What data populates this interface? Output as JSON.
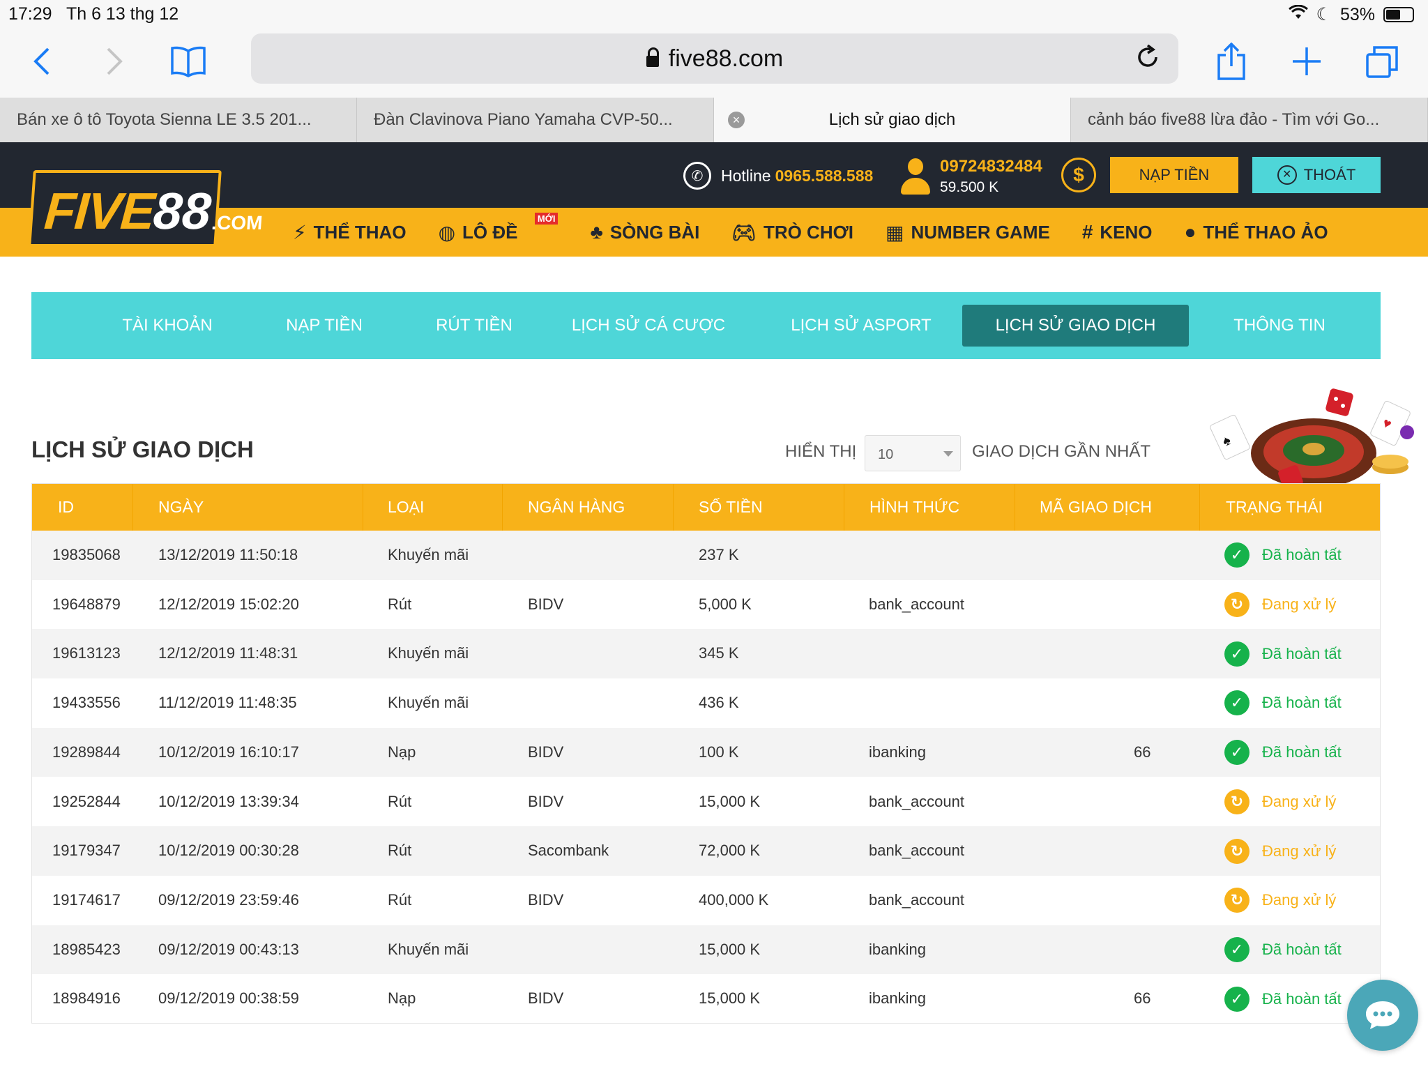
{
  "status_bar": {
    "time": "17:29",
    "date": "Th 6 13 thg 12",
    "battery_percent": "53%"
  },
  "browser": {
    "url": "five88.com",
    "tabs": [
      {
        "title": "Bán xe ô tô Toyota Sienna LE 3.5 201..."
      },
      {
        "title": "Đàn Clavinova Piano Yamaha CVP-50..."
      },
      {
        "title": "Lịch sử giao dịch"
      },
      {
        "title": "cảnh báo five88 lừa đảo - Tìm với Go..."
      }
    ]
  },
  "header": {
    "logo": {
      "part1": "FIVE",
      "part2": "88",
      "part3": ".COM"
    },
    "hotline_label": "Hotline",
    "hotline_number": "0965.588.588",
    "user_phone": "09724832484",
    "user_balance": "59.500 K",
    "deposit_button": "NẠP TIỀN",
    "logout_button": "THOÁT"
  },
  "nav": {
    "items": [
      {
        "label": "THỂ THAO"
      },
      {
        "label": "LÔ ĐỀ",
        "badge": "MỚI"
      },
      {
        "label": "SÒNG BÀI"
      },
      {
        "label": "TRÒ CHƠI"
      },
      {
        "label": "NUMBER GAME"
      },
      {
        "label": "KENO"
      },
      {
        "label": "THỂ THAO ẢO"
      }
    ]
  },
  "account_tabs": [
    {
      "label": "TÀI KHOẢN"
    },
    {
      "label": "NẠP TIỀN"
    },
    {
      "label": "RÚT TIỀN"
    },
    {
      "label": "LỊCH SỬ CÁ CƯỢC"
    },
    {
      "label": "LỊCH SỬ ASPORT"
    },
    {
      "label": "LỊCH SỬ GIAO DỊCH",
      "active": true
    },
    {
      "label": "THÔNG TIN"
    }
  ],
  "section": {
    "title": "LỊCH SỬ GIAO DỊCH",
    "show_label": "HIỂN THỊ",
    "show_value": "10",
    "show_after": "GIAO DỊCH GẦN NHẤT"
  },
  "table": {
    "columns": [
      "ID",
      "NGÀY",
      "LOẠI",
      "NGÂN HÀNG",
      "SỐ TIỀN",
      "HÌNH THỨC",
      "MÃ GIAO DỊCH",
      "TRẠNG THÁI"
    ],
    "rows": [
      {
        "id": "19835068",
        "date": "13/12/2019 11:50:18",
        "type": "Khuyến mãi",
        "bank": "",
        "amount": "237 K",
        "method": "",
        "code": "",
        "status": "Đã hoàn tất",
        "state": "done"
      },
      {
        "id": "19648879",
        "date": "12/12/2019 15:02:20",
        "type": "Rút",
        "bank": "BIDV",
        "amount": "5,000 K",
        "method": "bank_account",
        "code": "",
        "status": "Đang xử lý",
        "state": "pending"
      },
      {
        "id": "19613123",
        "date": "12/12/2019 11:48:31",
        "type": "Khuyến mãi",
        "bank": "",
        "amount": "345 K",
        "method": "",
        "code": "",
        "status": "Đã hoàn tất",
        "state": "done"
      },
      {
        "id": "19433556",
        "date": "11/12/2019 11:48:35",
        "type": "Khuyến mãi",
        "bank": "",
        "amount": "436 K",
        "method": "",
        "code": "",
        "status": "Đã hoàn tất",
        "state": "done"
      },
      {
        "id": "19289844",
        "date": "10/12/2019 16:10:17",
        "type": "Nạp",
        "bank": "BIDV",
        "amount": "100 K",
        "method": "ibanking",
        "code": "66",
        "status": "Đã hoàn tất",
        "state": "done"
      },
      {
        "id": "19252844",
        "date": "10/12/2019 13:39:34",
        "type": "Rút",
        "bank": "BIDV",
        "amount": "15,000 K",
        "method": "bank_account",
        "code": "",
        "status": "Đang xử lý",
        "state": "pending"
      },
      {
        "id": "19179347",
        "date": "10/12/2019 00:30:28",
        "type": "Rút",
        "bank": "Sacombank",
        "amount": "72,000 K",
        "method": "bank_account",
        "code": "",
        "status": "Đang xử lý",
        "state": "pending"
      },
      {
        "id": "19174617",
        "date": "09/12/2019 23:59:46",
        "type": "Rút",
        "bank": "BIDV",
        "amount": "400,000 K",
        "method": "bank_account",
        "code": "",
        "status": "Đang xử lý",
        "state": "pending"
      },
      {
        "id": "18985423",
        "date": "09/12/2019 00:43:13",
        "type": "Khuyến mãi",
        "bank": "",
        "amount": "15,000 K",
        "method": "ibanking",
        "code": "",
        "status": "Đã hoàn tất",
        "state": "done"
      },
      {
        "id": "18984916",
        "date": "09/12/2019 00:38:59",
        "type": "Nạp",
        "bank": "BIDV",
        "amount": "15,000 K",
        "method": "ibanking",
        "code": "66",
        "status": "Đã hoàn tất",
        "state": "done"
      }
    ]
  },
  "colors": {
    "brand_yellow": "#f8b219",
    "dark": "#222730",
    "teal": "#4ed6d8",
    "teal_active": "#1f7b7b",
    "success": "#16b24b"
  },
  "icons": [
    "back-icon",
    "forward-icon",
    "bookmarks-icon",
    "lock-icon",
    "reload-icon",
    "share-icon",
    "new-tab-icon",
    "tabs-icon",
    "phone-icon",
    "user-icon",
    "coin-icon",
    "close-circle-icon",
    "chat-icon"
  ]
}
